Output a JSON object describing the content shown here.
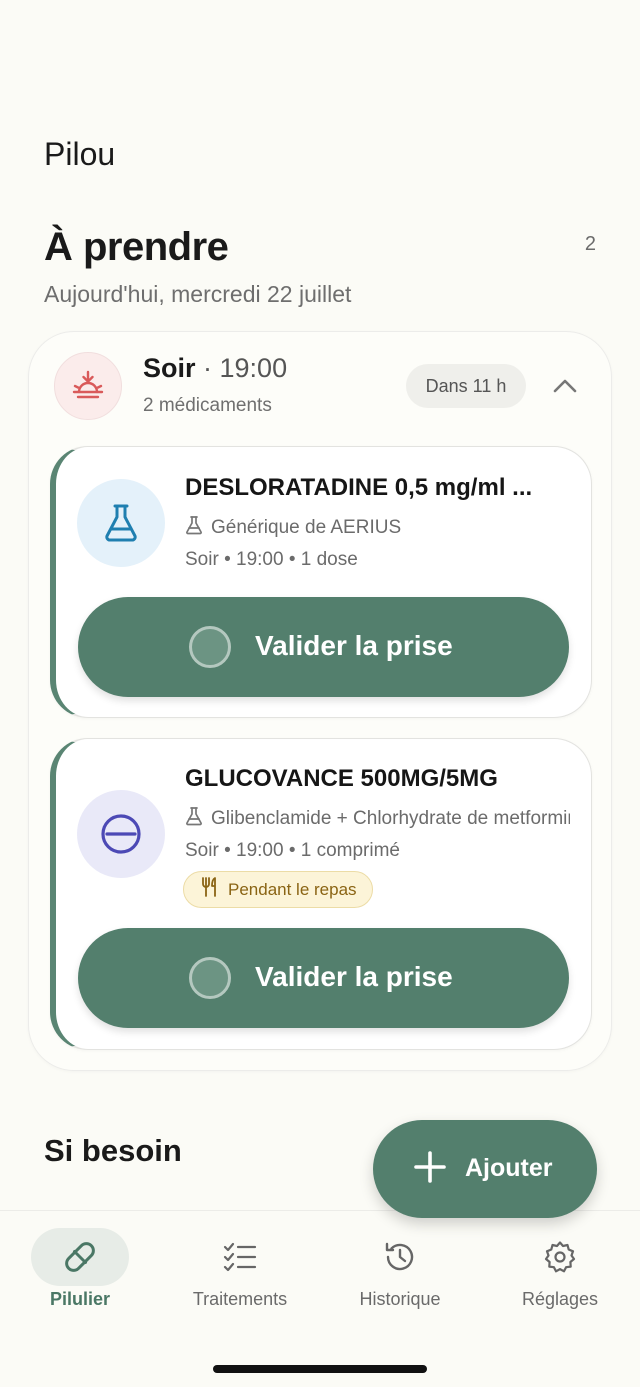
{
  "app": {
    "title": "Pilou"
  },
  "section": {
    "title": "À prendre",
    "count": "2",
    "date": "Aujourd'hui, mercredi 22 juillet"
  },
  "group": {
    "period": "Soir",
    "separator": " · ",
    "time": "19:00",
    "subtitle": "2 médicaments",
    "badge": "Dans 11 h",
    "icon": "sunset-icon",
    "icon_color": "#d95a5a"
  },
  "medications": [
    {
      "name": "DESLORATADINE 0,5 mg/ml ...",
      "generic": "Générique de AERIUS",
      "detail": "Soir • 19:00 • 1 dose",
      "icon": "flask-icon",
      "icon_color": "#1f7fb0",
      "icon_bg": "#e4f1fa",
      "action": "Valider la prise"
    },
    {
      "name": "GLUCOVANCE 500MG/5MG",
      "generic": "Glibenclamide + Chlorhydrate de metformine",
      "detail": "Soir • 19:00 • 1 comprimé",
      "badge": "Pendant le repas",
      "icon": "pill-tablet-icon",
      "icon_color": "#4c49b5",
      "icon_bg": "#e9e9f8",
      "action": "Valider la prise"
    }
  ],
  "si_besoin": {
    "title": "Si besoin"
  },
  "fab": {
    "label": "Ajouter"
  },
  "nav": [
    {
      "label": "Pilulier",
      "icon": "pill-icon",
      "active": true
    },
    {
      "label": "Traitements",
      "icon": "checklist-icon",
      "active": false
    },
    {
      "label": "Historique",
      "icon": "history-icon",
      "active": false
    },
    {
      "label": "Réglages",
      "icon": "gear-icon",
      "active": false
    }
  ],
  "colors": {
    "accent": "#537f6d",
    "background": "#fbfbf6",
    "meal_badge": "#fcf4d8"
  }
}
